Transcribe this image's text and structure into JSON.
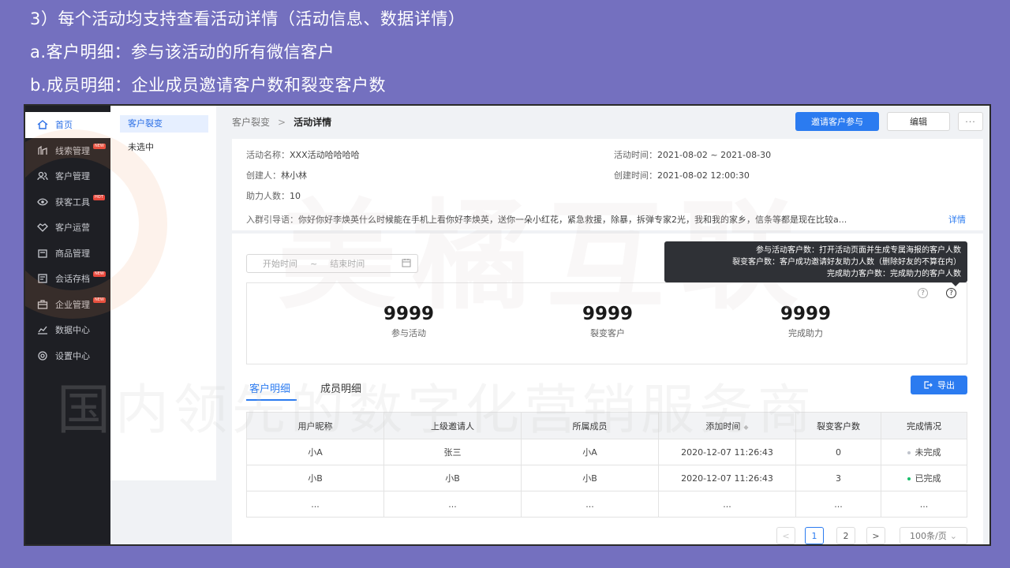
{
  "slide": {
    "line1": "3）每个活动均支持查看活动详情（活动信息、数据详情）",
    "line2": "a.客户明细：参与该活动的所有微信客户",
    "line3": "b.成员明细：企业成员邀请客户数和裂变客户数"
  },
  "sidebar": {
    "items": [
      {
        "label": "首页",
        "icon": "home-icon"
      },
      {
        "label": "线索管理",
        "icon": "leads-icon",
        "badge": "NEW"
      },
      {
        "label": "客户管理",
        "icon": "users-icon"
      },
      {
        "label": "获客工具",
        "icon": "eye-icon",
        "badge": "HOT"
      },
      {
        "label": "客户运营",
        "icon": "handshake-icon"
      },
      {
        "label": "商品管理",
        "icon": "product-icon"
      },
      {
        "label": "会话存档",
        "icon": "chat-archive-icon",
        "badge": "NEW"
      },
      {
        "label": "企业管理",
        "icon": "briefcase-icon",
        "badge": "NEW"
      },
      {
        "label": "数据中心",
        "icon": "chart-icon"
      },
      {
        "label": "设置中心",
        "icon": "settings-icon"
      }
    ]
  },
  "subnav": {
    "active": "客户裂变",
    "plain": "未选中"
  },
  "breadcrumb": {
    "parent": "客户裂变",
    "sep": ">",
    "current": "活动详情"
  },
  "toolbar": {
    "invite": "邀请客户参与",
    "edit": "编辑",
    "more": "···"
  },
  "info": {
    "name_label": "活动名称：",
    "name": "XXX活动哈哈哈哈",
    "time_label": "活动时间：",
    "time": "2021-08-02 ~ 2021-08-30",
    "creator_label": "创建人：",
    "creator": "林小林",
    "created_label": "创建时间：",
    "created": "2021-08-02  12:00:30",
    "helpers_label": "助力人数：",
    "helpers": "10",
    "guide_label": "入群引导语：",
    "guide": "你好你好李焕英什么时候能在手机上看你好李焕英，送你一朵小红花，紧急救援，除暴，拆弹专家2光，我和我的家乡，信条等都是现在比较a...",
    "detail_link": "详情"
  },
  "filter": {
    "start": "开始时间",
    "tilde": "~",
    "end": "结束时间"
  },
  "tooltip": {
    "line1": "参与活动客户数：打开活动页面并生成专属海报的客户人数",
    "line2": "裂变客户数：客户成功邀请好友助力人数（删除好友的不算在内）",
    "line3": "完成助力客户数：完成助力的客户人数"
  },
  "stats": [
    {
      "value": "9999",
      "label": "参与活动"
    },
    {
      "value": "9999",
      "label": "裂变客户"
    },
    {
      "value": "9999",
      "label": "完成助力"
    }
  ],
  "tabs": {
    "customers": "客户明细",
    "members": "成员明细"
  },
  "export_label": "导出",
  "table": {
    "headers": [
      "用户昵称",
      "上级邀请人",
      "所属成员",
      "添加时间",
      "裂变客户数",
      "完成情况"
    ],
    "rows": [
      [
        "小A",
        "张三",
        "小A",
        "2020-12-07  11:26:43",
        "0",
        "未完成"
      ],
      [
        "小B",
        "小B",
        "小B",
        "2020-12-07  11:26:43",
        "3",
        "已完成"
      ],
      [
        "...",
        "...",
        "...",
        "...",
        "...",
        "..."
      ]
    ],
    "status_colors": {
      "未完成": "#c0c4cc",
      "已完成": "#19be6b"
    }
  },
  "pagination": {
    "prev": "<",
    "pages": [
      "1",
      "2"
    ],
    "next": ">",
    "page_size": "100条/页"
  },
  "watermark": {
    "big": "美橘互联",
    "small": "国内领先的数字化营销服务商"
  },
  "colors": {
    "accent": "#2b7bf0",
    "sidebar_bg": "#1e1f24",
    "slide_bg": "#7470bf"
  }
}
